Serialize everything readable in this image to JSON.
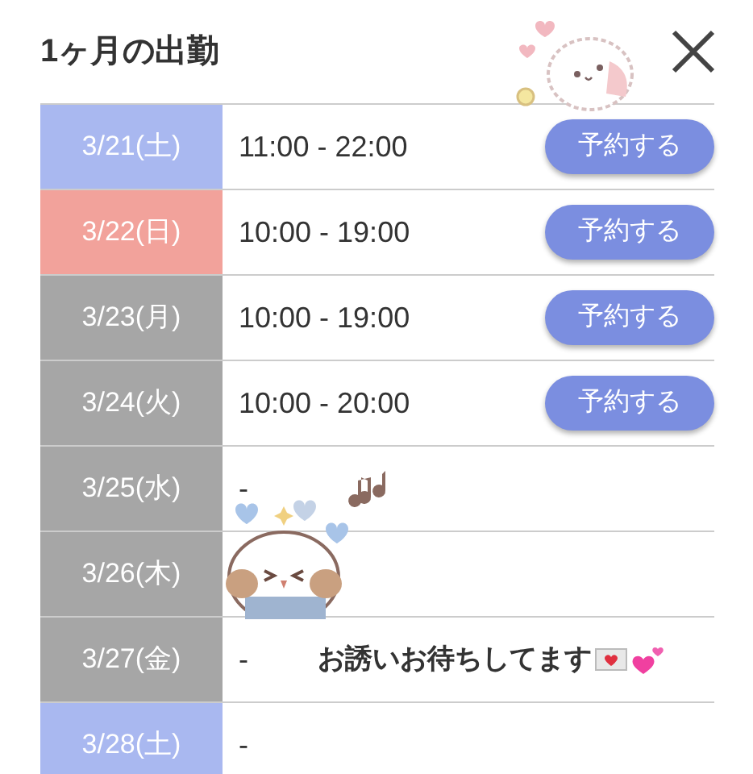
{
  "title": "1ヶ月の出勤",
  "rows": [
    {
      "date": "3/21(土)",
      "color": "#a9b8f0",
      "time": "11:00 - 22:00",
      "button": "予約する"
    },
    {
      "date": "3/22(日)",
      "color": "#f2a29b",
      "time": "10:00 - 19:00",
      "button": "予約する"
    },
    {
      "date": "3/23(月)",
      "color": "#a6a6a6",
      "time": "10:00 - 19:00",
      "button": "予約する"
    },
    {
      "date": "3/24(火)",
      "color": "#a6a6a6",
      "time": "10:00 - 20:00",
      "button": "予約する"
    },
    {
      "date": "3/25(水)",
      "color": "#a6a6a6",
      "time": "-"
    },
    {
      "date": "3/26(木)",
      "color": "#a6a6a6"
    },
    {
      "date": "3/27(金)",
      "color": "#a6a6a6",
      "time": "-"
    },
    {
      "date": "3/28(土)",
      "color": "#a9b8f0",
      "time": "-"
    }
  ],
  "message": "お誘いお待ちしてます"
}
